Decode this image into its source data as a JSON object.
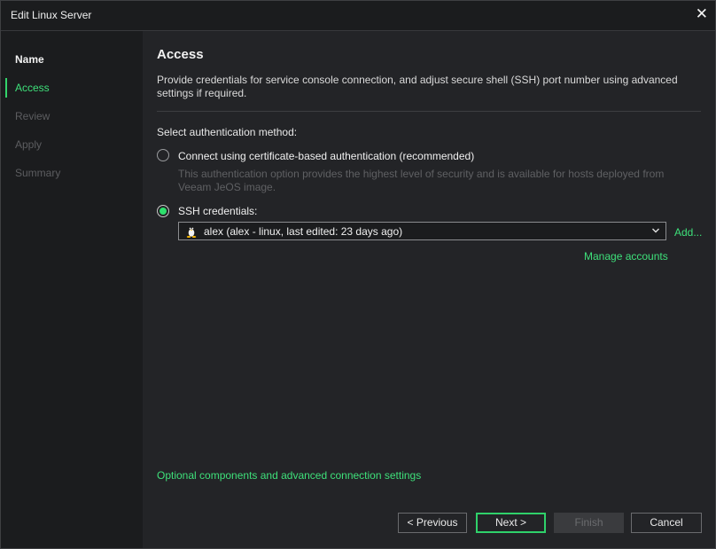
{
  "window": {
    "title": "Edit Linux Server"
  },
  "sidebar": {
    "steps": [
      {
        "label": "Name",
        "state": "done"
      },
      {
        "label": "Access",
        "state": "active"
      },
      {
        "label": "Review",
        "state": "todo"
      },
      {
        "label": "Apply",
        "state": "todo"
      },
      {
        "label": "Summary",
        "state": "todo"
      }
    ]
  },
  "main": {
    "heading": "Access",
    "description": "Provide credentials for service console connection, and adjust secure shell (SSH) port number using advanced settings if required.",
    "auth_label": "Select authentication method:",
    "options": [
      {
        "label": "Connect using certificate-based authentication (recommended)",
        "description": "This authentication option provides the highest level of security and is available for hosts deployed from Veeam JeOS image.",
        "checked": false
      },
      {
        "label": "SSH credentials:",
        "checked": true
      }
    ],
    "credential_value": "alex (alex - linux, last edited: 23 days ago)",
    "add_link": "Add...",
    "manage_link": "Manage accounts",
    "advanced_link": "Optional components and advanced connection settings"
  },
  "buttons": {
    "previous": "< Previous",
    "next": "Next >",
    "finish": "Finish",
    "cancel": "Cancel"
  },
  "colors": {
    "accent": "#33d46b",
    "background": "#232427",
    "sidebar": "#1b1c1e"
  },
  "icons": {
    "close": "close-icon",
    "credential": "linux-penguin-icon",
    "dropdown": "chevron-down-icon"
  }
}
